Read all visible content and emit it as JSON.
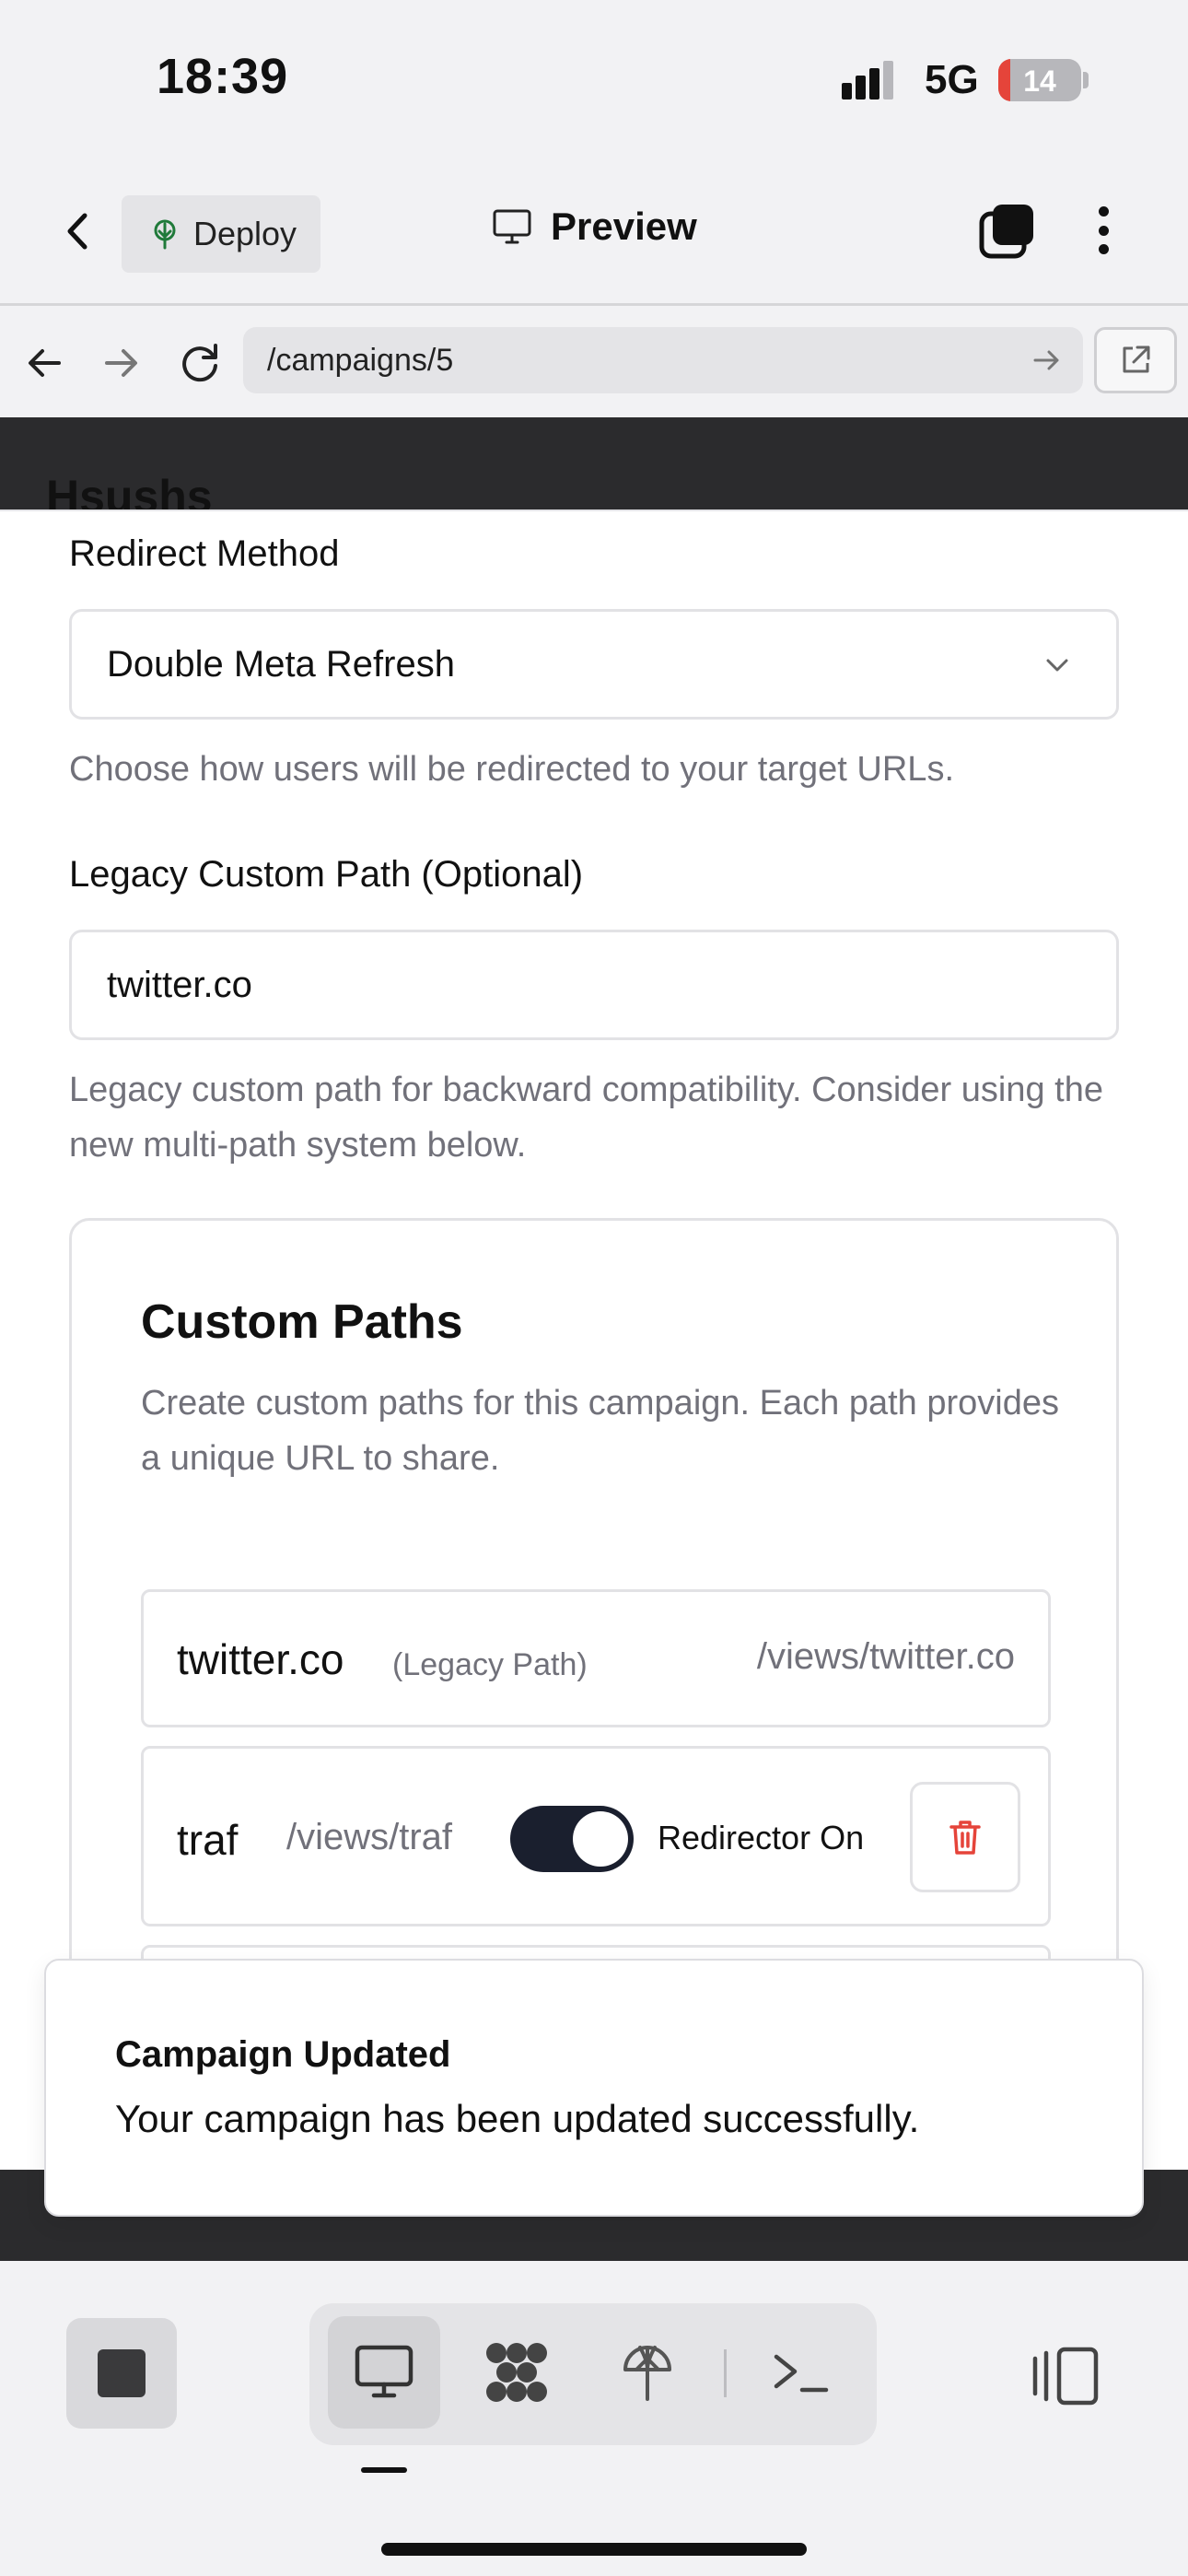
{
  "status_bar": {
    "time": "18:39",
    "network": "5G",
    "battery_level": "14",
    "battery_fraction": 0.14
  },
  "header": {
    "deploy_label": "Deploy",
    "title": "Preview"
  },
  "browser": {
    "url": "/campaigns/5"
  },
  "page_background": {
    "title": "Hsushs",
    "bottom_text": ""
  },
  "form": {
    "redirect_method": {
      "label": "Redirect Method",
      "value": "Double Meta Refresh",
      "help": "Choose how users will be redirected to your target URLs."
    },
    "legacy_path": {
      "label": "Legacy Custom Path (Optional)",
      "value": "twitter.co",
      "help": "Legacy custom path for backward compatibility. Consider using the new multi-path system below."
    },
    "custom_paths": {
      "title": "Custom Paths",
      "description": "Create custom paths for this campaign. Each path provides a unique URL to share.",
      "legacy_row": {
        "name": "twitter.co",
        "tag": "(Legacy Path)",
        "url": "/views/twitter.co"
      },
      "rows": [
        {
          "name": "traf",
          "url": "/views/traf",
          "redirector_on": true,
          "redirector_label": "Redirector On"
        }
      ]
    }
  },
  "toast": {
    "title": "Campaign Updated",
    "message": "Your campaign has been updated successfully."
  },
  "colors": {
    "toggle_on": "#1a1f2e",
    "delete_red": "#e5443a",
    "deploy_green": "#1f7a3a",
    "muted_text": "#71717a"
  },
  "icons": [
    "back-icon",
    "deploy-tree-icon",
    "monitor-icon",
    "tabs-icon",
    "more-icon",
    "arrow-left-icon",
    "arrow-right-icon",
    "reload-icon",
    "external-link-icon",
    "chevron-down-icon",
    "trash-icon",
    "stop-icon",
    "desktop-icon",
    "apps-icon",
    "deploy-icon",
    "console-icon",
    "split-view-icon"
  ]
}
